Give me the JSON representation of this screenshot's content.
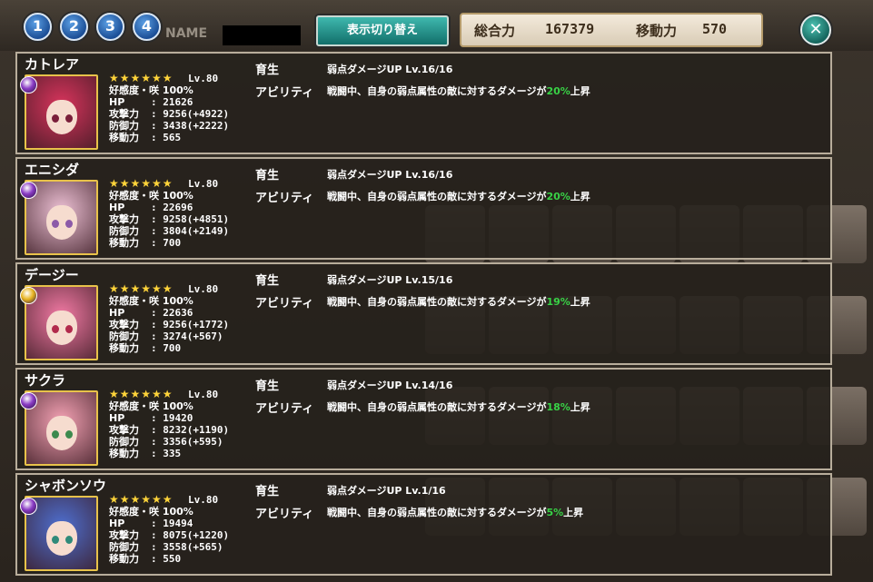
{
  "topbar": {
    "numbers": [
      "1",
      "2",
      "3",
      "4"
    ],
    "name_label": "NAME",
    "switch_label": "表示切り替え",
    "total_power_label": "総合力",
    "total_power_value": "167379",
    "move_power_label": "移動力",
    "move_power_value": "570",
    "close_symbol": "✕"
  },
  "labels": {
    "stars": "★★★★★★",
    "affection": "好感度・咲 100%",
    "hp": "HP",
    "atk": "攻撃力",
    "def": "防御力",
    "move": "移動力",
    "training": "育生",
    "ability": "アビリティ",
    "ability_pre": "戦闘中、自身の弱点属性の敵に対するダメージが",
    "ability_post": "上昇"
  },
  "colors": {
    "accent_teal": "#1c8f88",
    "percent_green": "#38d246",
    "star_gold": "#ffd43a",
    "panel_border": "#b8ad9b"
  },
  "characters": [
    {
      "name": "カトレア",
      "level": "Lv.80",
      "hp": ": 21626",
      "atk": ": 9256(+4922)",
      "def": ": 3438(+2222)",
      "move": ": 565",
      "training": "弱点ダメージUP Lv.16/16",
      "percent": "20%",
      "element_icon": "dark-element-orb",
      "element_color": "#8a3bc4",
      "hair_color": "#d8345c",
      "eye_color": "#7a1e3a"
    },
    {
      "name": "エニシダ",
      "level": "Lv.80",
      "hp": ": 22696",
      "atk": ": 9258(+4851)",
      "def": ": 3804(+2149)",
      "move": ": 700",
      "training": "弱点ダメージUP Lv.16/16",
      "percent": "20%",
      "element_icon": "dark-element-orb",
      "element_color": "#8a3bc4",
      "hair_color": "#ecc0d4",
      "eye_color": "#8c5aa8"
    },
    {
      "name": "デージー",
      "level": "Lv.80",
      "hp": ": 22636",
      "atk": ": 9256(+1772)",
      "def": ": 3274(+567)",
      "move": ": 700",
      "training": "弱点ダメージUP Lv.15/16",
      "percent": "19%",
      "element_icon": "light-element-orb",
      "element_color": "#e7b421",
      "hair_color": "#f27aa4",
      "eye_color": "#b22a4c"
    },
    {
      "name": "サクラ",
      "level": "Lv.80",
      "hp": ": 19420",
      "atk": ": 8232(+1190)",
      "def": ": 3356(+595)",
      "move": ": 335",
      "training": "弱点ダメージUP Lv.14/16",
      "percent": "18%",
      "element_icon": "dark-element-orb",
      "element_color": "#8a3bc4",
      "hair_color": "#f4a2b4",
      "eye_color": "#3d8a4e"
    },
    {
      "name": "シャボンソウ",
      "level": "Lv.80",
      "hp": ": 19494",
      "atk": ": 8075(+1220)",
      "def": ": 3558(+565)",
      "move": ": 550",
      "training": "弱点ダメージUP Lv.1/16",
      "percent": "5%",
      "element_icon": "dark-element-orb",
      "element_color": "#8a3bc4",
      "hair_color": "#4e6fd0",
      "eye_color": "#2f8a7a"
    }
  ]
}
